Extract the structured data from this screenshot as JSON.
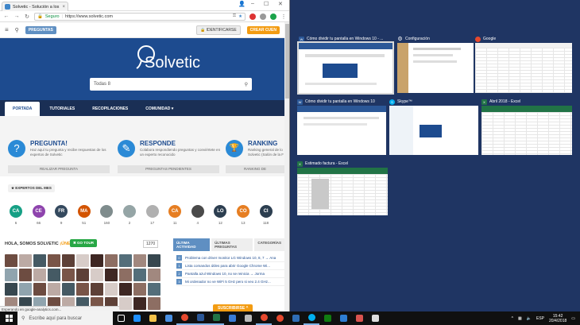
{
  "browser": {
    "tab_title": "Solvetic - Solución a los ...",
    "secure_label": "Seguro",
    "url": "https://www.solvetic.com"
  },
  "site": {
    "preguntas_button": "PREGUNTAS",
    "identify_button": "IDENTIFICARSE",
    "create_account_button": "CREAR CUEN",
    "logo_text": "Solvetic",
    "search_placeholder": "Todas 8",
    "nav": [
      "PORTADA",
      "TUTORIALES",
      "RECOPILACIONES",
      "COMUNIDAD ▾"
    ],
    "features": [
      {
        "title": "PREGUNTA!",
        "desc": "Haz aquí tu pregunta y recibe respuestas de los expertos de Solvetic",
        "button": "REALIZAR PREGUNTA",
        "icon": "?"
      },
      {
        "title": "RESPONDE",
        "desc": "Colabora respondiendo preguntas y conviértete en un experto reconocido",
        "button": "PREGUNTAS PENDIENTES",
        "icon": "✎"
      },
      {
        "title": "RANKING",
        "desc": "Ranking general de lo Solvetic (Salón de la F",
        "button": "RANKING DE",
        "icon": "🏆"
      }
    ],
    "experts_header": "★ EXPERTOS DEL MES",
    "experts": [
      {
        "initials": "CA",
        "color": "#16a085",
        "count": "6"
      },
      {
        "initials": "CE",
        "color": "#8e44ad",
        "count": "66"
      },
      {
        "initials": "FR",
        "color": "#34495e",
        "count": "9"
      },
      {
        "initials": "MA",
        "color": "#d35400",
        "count": "51"
      },
      {
        "initials": "",
        "color": "#7f8c8d",
        "count": "160"
      },
      {
        "initials": "",
        "color": "#95a5a6",
        "count": "2"
      },
      {
        "initials": "",
        "color": "#b0b0b0",
        "count": "17"
      },
      {
        "initials": "CA",
        "color": "#e67e22",
        "count": "11"
      },
      {
        "initials": "",
        "color": "#4a4a4a",
        "count": "4"
      },
      {
        "initials": "LO",
        "color": "#2c3e50",
        "count": "12"
      },
      {
        "initials": "CO",
        "color": "#e67e22",
        "count": "13"
      },
      {
        "initials": "CI",
        "color": "#2c3e50",
        "count": "118"
      }
    ],
    "hola_text": "HOLA, SOMOS SOLVETIC ",
    "hola_highlight": "¡ÚNETE!",
    "go_tour": "✖ GO TOUR",
    "counter_value": "1270",
    "activity_tabs": [
      "ÚLTIMA ACTIVIDAD",
      "ÚLTIMAS PREGUNTAS",
      "CATEGORÍAS"
    ],
    "activity_items": [
      {
        "num": "0",
        "text": "Problema con driver monitor LG Windows 10, 8, 7 → Ana"
      },
      {
        "num": "1",
        "text": "Lista comandos útiles para abrir Google Chrome Wi..."
      },
      {
        "num": "2",
        "text": "Pantalla azul Windows 10, no se reinicia → Jorma"
      },
      {
        "num": "3",
        "text": "Mi ordenador no ve WiFi 5 GHz pero si veo 2.4 GHz..."
      }
    ],
    "subscribe_button": "SUSCRIBIRSE ^",
    "status_text": "Esperando en google-analytics.com..."
  },
  "taskview": {
    "windows": [
      {
        "title": "Cómo dividir tu pantalla en Windows 10 - ...",
        "app": "word"
      },
      {
        "title": "Configuración",
        "app": "settings"
      },
      {
        "title": "Google",
        "app": "chrome"
      },
      {
        "title": "Cómo dividir tu pantalla en Windows 10",
        "app": "word"
      },
      {
        "title": "Skype™",
        "app": "skype"
      },
      {
        "title": "Abril 2018 - Excel",
        "app": "excel"
      },
      {
        "title": "Estimado factura - Excel",
        "app": "excel"
      }
    ]
  },
  "taskbar": {
    "search_placeholder": "Escribe aquí para buscar",
    "time": "15:42",
    "date": "20/4/2018",
    "lang": "ESP",
    "pinned": [
      "task-view",
      "edge",
      "explorer",
      "store",
      "chrome",
      "word",
      "excel",
      "mail",
      "settings",
      "chrome2",
      "chrome3",
      "vm",
      "skype",
      "xbox",
      "photos",
      "paint",
      "gear"
    ]
  },
  "colors": {
    "desktop_bg": "#1f3563",
    "site_blue": "#1d4b8f",
    "accent_orange": "#f39c12"
  }
}
